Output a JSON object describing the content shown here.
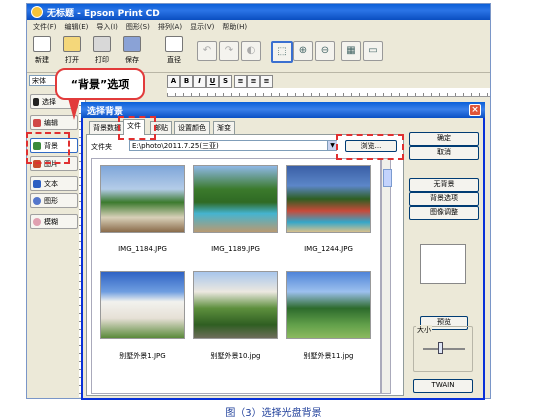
{
  "app": {
    "title": "无标题 - Epson Print CD",
    "menu": [
      "文件(F)",
      "编辑(E)",
      "导入(I)",
      "图形(S)",
      "排列(A)",
      "显示(V)",
      "帮助(H)"
    ],
    "toolbar": {
      "new": "新建",
      "open": "打开",
      "print": "打印",
      "save": "保存",
      "last": "直径"
    },
    "font_value": "宋体",
    "format_buttons": [
      "A",
      "B",
      "I",
      "U",
      "S"
    ],
    "sidebar": [
      "选择",
      "编辑",
      "背景",
      "图片",
      "文本",
      "图形",
      "模糊"
    ]
  },
  "callout": "“背景”选项",
  "dialog": {
    "title": "选择背景",
    "tabs": [
      "背景数据",
      "文件",
      "邮贴",
      "设置颜色",
      "渐变"
    ],
    "active_tab_index": 1,
    "folder_label": "文件夹",
    "folder_path": "E:\\photo\\2011.7.25(三亚)",
    "browse_label": "浏览...",
    "thumbnails": [
      {
        "caption": "IMG_1184.JPG"
      },
      {
        "caption": "IMG_1189.JPG"
      },
      {
        "caption": "IMG_1244.JPG"
      },
      {
        "caption": "别墅外景1.JPG"
      },
      {
        "caption": "别墅外景10.jpg"
      },
      {
        "caption": "别墅外景11.jpg"
      }
    ],
    "buttons": {
      "ok": "确定",
      "cancel": "取消",
      "no_background": "无背景",
      "background_options": "背景选项",
      "image_adjust": "图像调整",
      "preview": "预览",
      "twain": "TWAIN"
    },
    "size_label": "大小"
  },
  "caption": "图（3）选择光盘背景",
  "colors": {
    "highlight": "#e03030",
    "title_blue": "#0a5fd8",
    "caption": "#1f3f9a"
  }
}
